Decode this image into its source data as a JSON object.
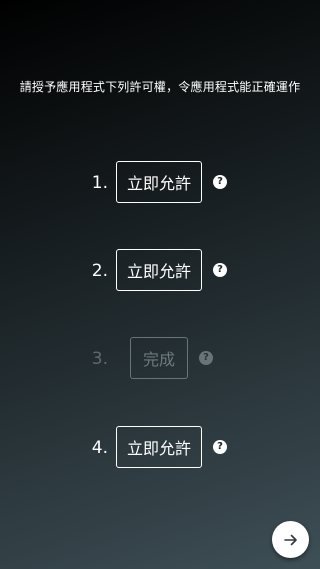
{
  "instruction": "請授予應用程式下列許可權，令應用程式能正確運作",
  "steps": [
    {
      "number": "1.",
      "label": "立即允許",
      "state": "pending",
      "help": "?"
    },
    {
      "number": "2.",
      "label": "立即允許",
      "state": "pending",
      "help": "?"
    },
    {
      "number": "3.",
      "label": "完成",
      "state": "done",
      "help": "?"
    },
    {
      "number": "4.",
      "label": "立即允許",
      "state": "pending",
      "help": "?"
    }
  ],
  "next_button": {
    "icon": "arrow-right-icon"
  },
  "colors": {
    "background_top": "#000000",
    "background_bottom": "#3e4f56",
    "text": "#ffffff",
    "disabled": "#6a7478"
  }
}
